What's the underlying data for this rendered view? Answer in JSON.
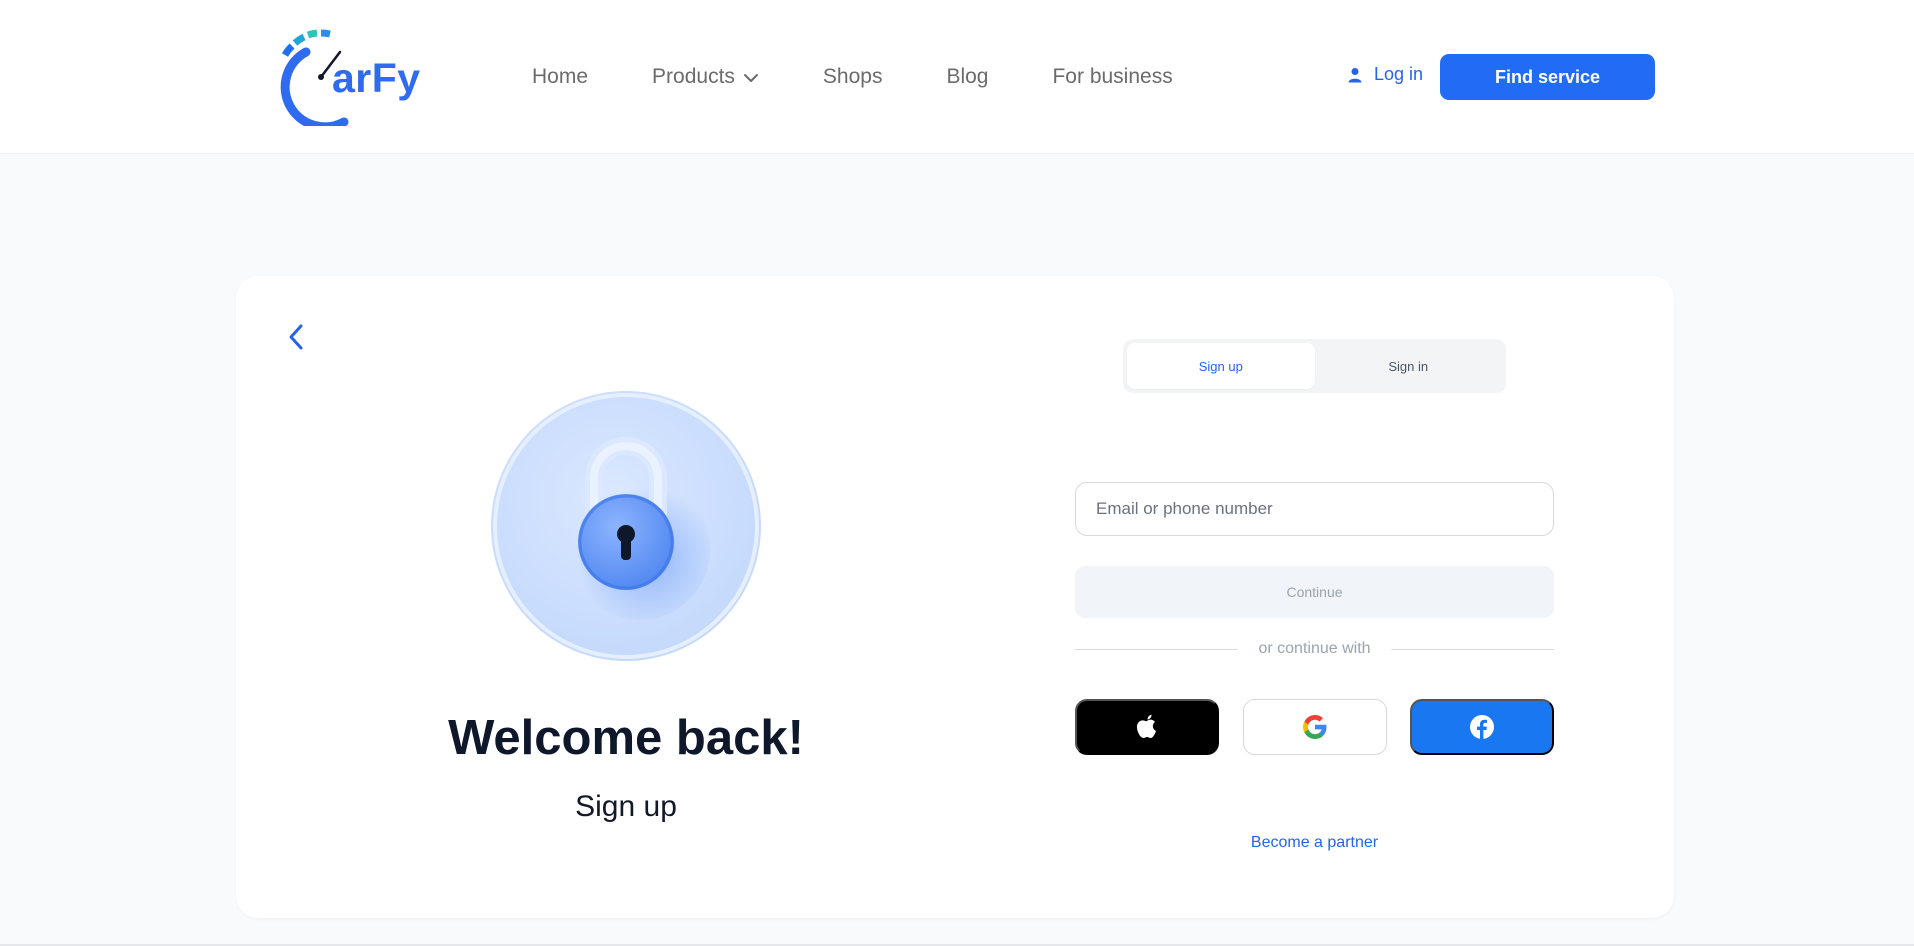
{
  "header": {
    "logo_text": "arFy",
    "nav": [
      {
        "label": "Home"
      },
      {
        "label": "Products",
        "has_dropdown": true
      },
      {
        "label": "Shops"
      },
      {
        "label": "Blog"
      },
      {
        "label": "For business"
      }
    ],
    "login_label": "Log in",
    "cta_label": "Find service"
  },
  "hero": {
    "title": "Welcome back!",
    "subtitle": "Sign up"
  },
  "auth": {
    "tabs": [
      {
        "label": "Sign up",
        "active": true
      },
      {
        "label": "Sign in",
        "active": false
      }
    ],
    "email_placeholder": "Email or phone number",
    "email_value": "",
    "continue_label": "Continue",
    "divider_text": "or continue with",
    "social": [
      {
        "provider": "apple",
        "icon": "apple-icon"
      },
      {
        "provider": "google",
        "icon": "google-icon"
      },
      {
        "provider": "facebook",
        "icon": "facebook-icon"
      }
    ],
    "partner_link": "Become a partner"
  },
  "colors": {
    "brand": "#226cf5",
    "link": "#2563eb",
    "page_bg": "#f8fafc",
    "facebook": "#1a77f2",
    "apple": "#000000"
  }
}
